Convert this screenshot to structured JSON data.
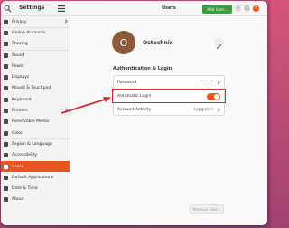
{
  "sidebar": {
    "title": "Settings",
    "items": [
      {
        "label": "Privacy",
        "icon": "privacy-icon",
        "chevron": true
      },
      {
        "label": "Online Accounts",
        "icon": "online-accounts-icon",
        "chevron": false
      },
      {
        "label": "Sharing",
        "icon": "sharing-icon",
        "chevron": false
      },
      {
        "label": "Sound",
        "icon": "sound-icon",
        "chevron": false
      },
      {
        "label": "Power",
        "icon": "power-icon",
        "chevron": false
      },
      {
        "label": "Displays",
        "icon": "displays-icon",
        "chevron": false
      },
      {
        "label": "Mouse & Touchpad",
        "icon": "mouse-icon",
        "chevron": false
      },
      {
        "label": "Keyboard",
        "icon": "keyboard-icon",
        "chevron": false
      },
      {
        "label": "Printers",
        "icon": "printer-icon",
        "chevron": true
      },
      {
        "label": "Removable Media",
        "icon": "removable-media-icon",
        "chevron": false
      },
      {
        "label": "Color",
        "icon": "color-icon",
        "chevron": false
      },
      {
        "label": "Region & Language",
        "icon": "region-icon",
        "chevron": false
      },
      {
        "label": "Accessibility",
        "icon": "accessibility-icon",
        "chevron": false
      },
      {
        "label": "Users",
        "icon": "users-icon",
        "chevron": false
      },
      {
        "label": "Default Applications",
        "icon": "default-apps-icon",
        "chevron": false
      },
      {
        "label": "Date & Time",
        "icon": "clock-icon",
        "chevron": false
      },
      {
        "label": "About",
        "icon": "about-icon",
        "chevron": false
      }
    ],
    "active_index": 13
  },
  "header": {
    "title": "Users",
    "add_user_label": "Add User..."
  },
  "user": {
    "avatar_initial": "O",
    "name": "Ostechnix"
  },
  "auth": {
    "section_title": "Authentication & Login",
    "password_label": "Password",
    "password_value": "•••••",
    "auto_login_label": "Automatic Login",
    "auto_login_enabled": true,
    "account_activity_label": "Account Activity",
    "account_activity_value": "Logged in"
  },
  "footer": {
    "remove_user_label": "Remove User..."
  },
  "colors": {
    "accent": "#e95420",
    "add_button": "#3f9a41",
    "highlight": "#d62a2a"
  }
}
